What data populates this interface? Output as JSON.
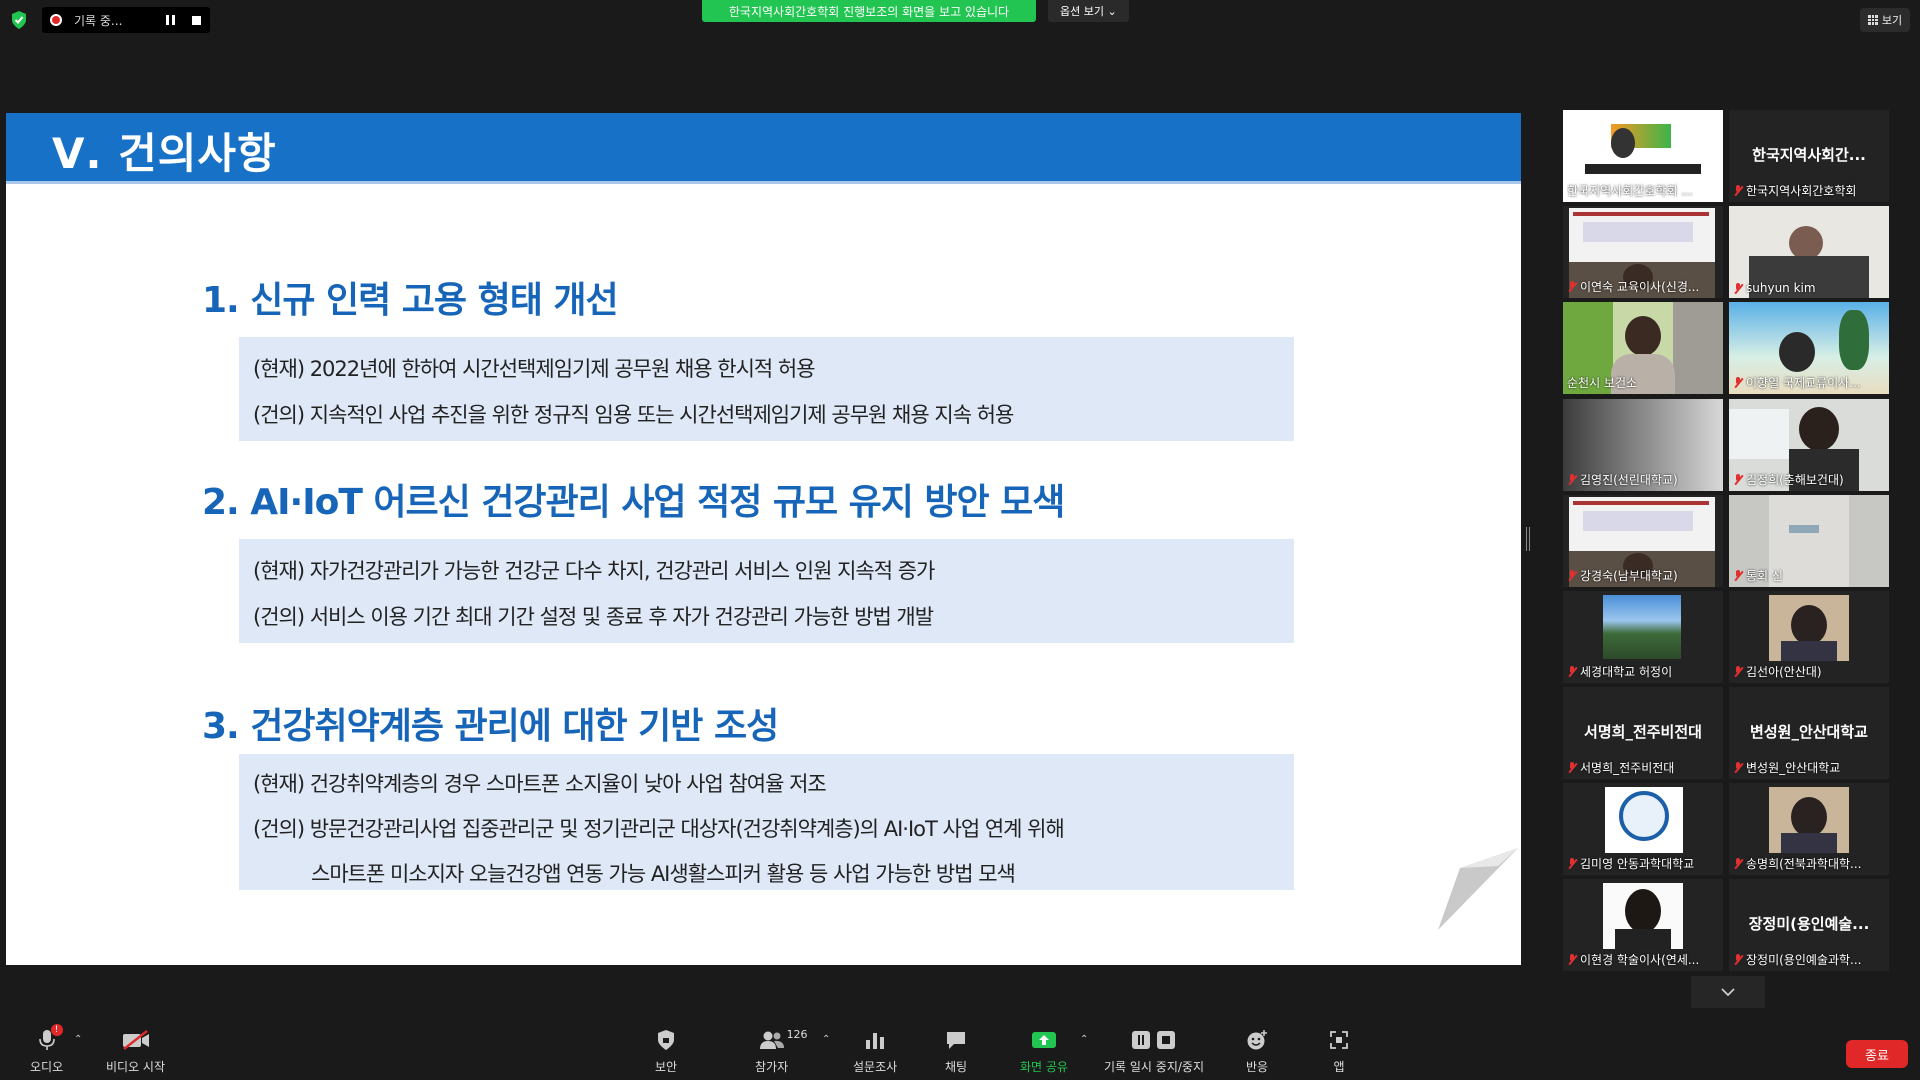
{
  "topbar": {
    "recording_label": "기록 중...",
    "share_banner": "한국지역사회간호학회 진행보조의 화면을 보고 있습니다",
    "view_options": "옵션 보기 ⌄",
    "view_button": "보기"
  },
  "slide": {
    "title": "Ⅴ. 건의사항",
    "sections": [
      {
        "heading": "1. 신규 인력 고용 형태 개선",
        "lines": [
          "(현재)  2022년에 한하여 시간선택제임기제 공무원 채용 한시적 허용",
          "(건의)  지속적인 사업 추진을 위한 정규직 임용 또는 시간선택제임기제 공무원 채용 지속 허용"
        ]
      },
      {
        "heading": "2. AI·IoT 어르신 건강관리 사업 적정 규모 유지 방안 모색",
        "lines": [
          "(현재)  자가건강관리가 가능한 건강군 다수 차지, 건강관리 서비스 인원 지속적 증가",
          "(건의)  서비스 이용 기간 최대 기간 설정 및 종료 후 자가 건강관리 가능한 방법 개발"
        ]
      },
      {
        "heading": "3. 건강취약계층 관리에 대한 기반 조성",
        "lines": [
          "(현재)  건강취약계층의 경우 스마트폰 소지율이 낮아 사업 참여율 저조",
          "(건의)  방문건강관리사업 집중관리군 및 정기관리군 대상자(건강취약계층)의 AI·IoT 사업 연계 위해",
          "스마트폰 미소지자 오늘건강앱 연동 가능 AI생활스피커 활용 등 사업 가능한 방법 모색"
        ]
      }
    ]
  },
  "participants": [
    {
      "name": "한국지역사회간호학회 ...",
      "big": "",
      "muted": false,
      "video": "logo"
    },
    {
      "name": "한국지역사회간호학회",
      "big": "한국지역사회간...",
      "muted": true,
      "video": "none"
    },
    {
      "name": "이연숙 교육이사(신경...",
      "big": "",
      "muted": true,
      "video": "screen"
    },
    {
      "name": "suhyun kim",
      "big": "",
      "muted": true,
      "video": "room"
    },
    {
      "name": "순천시 보건소",
      "big": "",
      "muted": false,
      "video": "person",
      "active": true
    },
    {
      "name": "이향열 국제교류이사...",
      "big": "",
      "muted": true,
      "video": "beach"
    },
    {
      "name": "김영진(선린대학교)",
      "big": "",
      "muted": true,
      "video": "blur"
    },
    {
      "name": "김정희(춘해보건대)",
      "big": "",
      "muted": true,
      "video": "office"
    },
    {
      "name": "강경숙(남부대학교)",
      "big": "",
      "muted": true,
      "video": "screen"
    },
    {
      "name": "통회 신",
      "big": "",
      "muted": true,
      "video": "ceiling"
    },
    {
      "name": "세경대학교 허정이",
      "big": "",
      "muted": true,
      "video": "campus"
    },
    {
      "name": "김선아(안산대)",
      "big": "",
      "muted": true,
      "video": "portrait"
    },
    {
      "name": "서명희_전주비전대",
      "big": "서명희_전주비전대",
      "muted": true,
      "video": "none"
    },
    {
      "name": "변성원_안산대학교",
      "big": "변성원_안산대학교",
      "muted": true,
      "video": "none"
    },
    {
      "name": "김미영 안동과학대학교",
      "big": "",
      "muted": true,
      "video": "emblem"
    },
    {
      "name": "송명희(전북과학대학...",
      "big": "",
      "muted": true,
      "video": "portrait"
    },
    {
      "name": "이현경 학술이사(연세...",
      "big": "",
      "muted": true,
      "video": "portrait2"
    },
    {
      "name": "장정미(용인예술과학...",
      "big": "장정미(용인예술...",
      "muted": true,
      "video": "none"
    }
  ],
  "toolbar": {
    "audio": "오디오",
    "video": "비디오 시작",
    "security": "보안",
    "participants": "참가자",
    "participant_count": "126",
    "polls": "설문조사",
    "chat": "채팅",
    "share": "화면 공유",
    "record": "기록 일시 중지/중지",
    "reactions": "반응",
    "apps": "앱",
    "end": "종료",
    "audio_badge": "!"
  },
  "colors": {
    "slide_blue": "#1771c6",
    "heading_blue": "#1665b8",
    "box_bg": "#dfe8f7",
    "banner_green": "#23c552",
    "end_red": "#e02828",
    "active_speaker": "#e6e63c"
  }
}
